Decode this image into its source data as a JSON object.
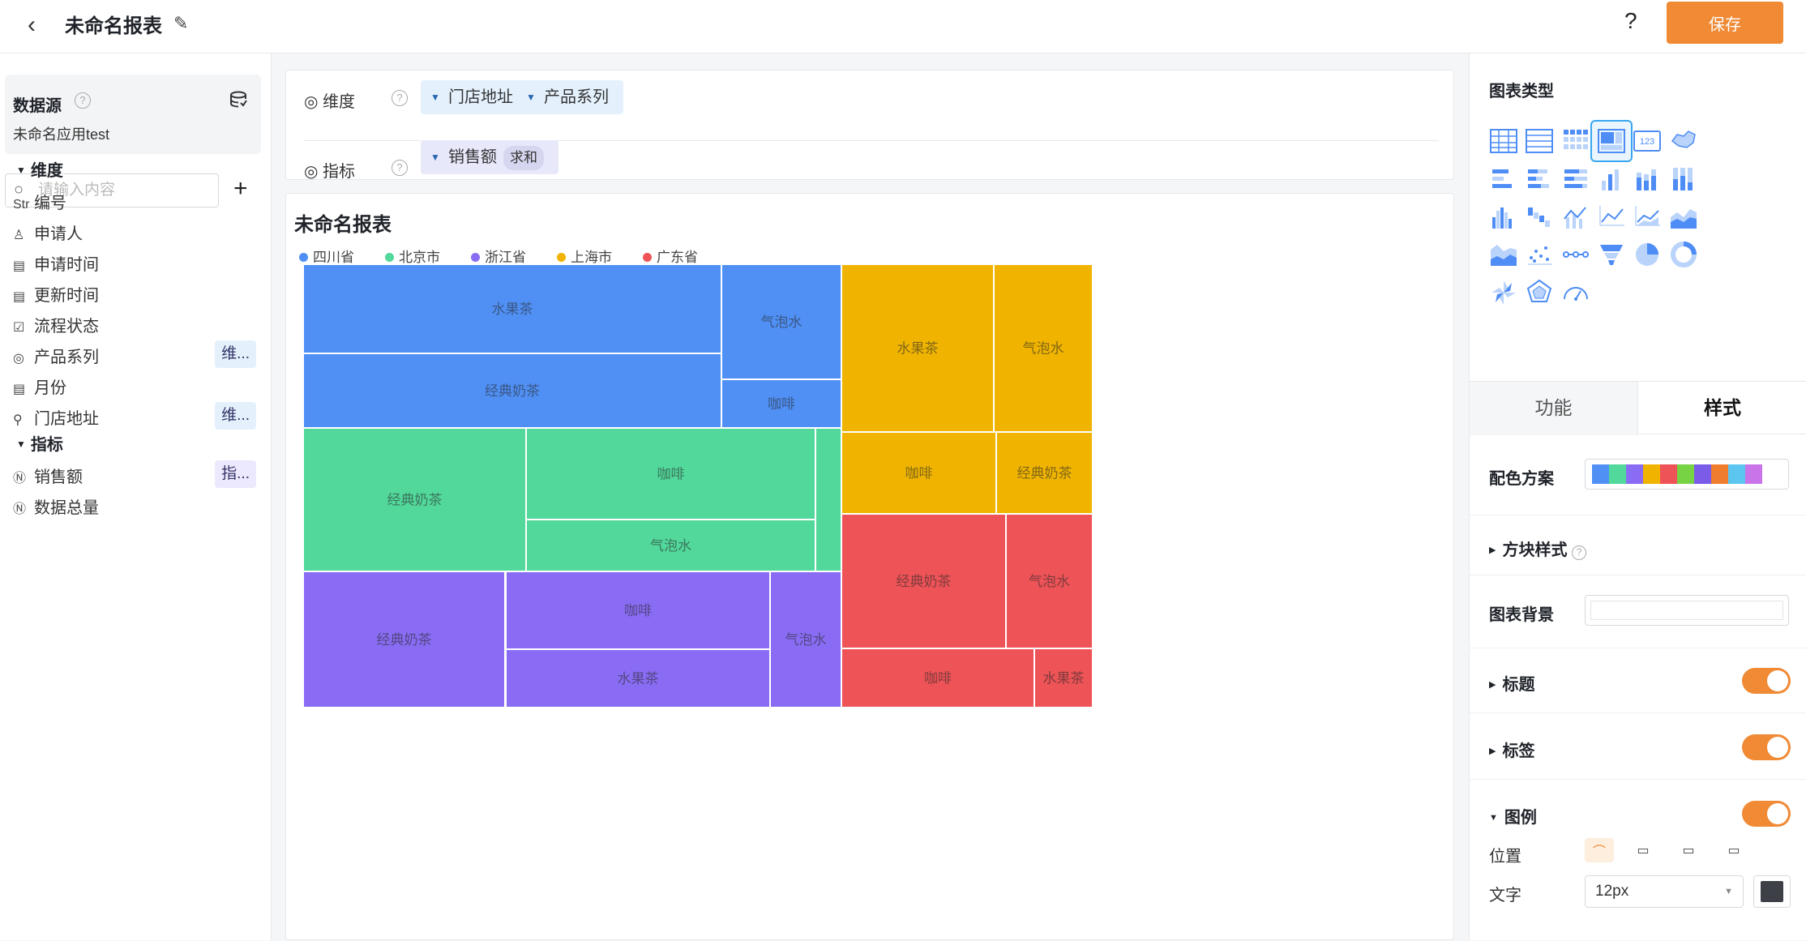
{
  "header": {
    "title": "未命名报表",
    "back_icon": "chevron-left-icon",
    "edit_icon": "pencil-icon",
    "help_label": "?",
    "save_label": "保存"
  },
  "sidebar": {
    "datasource_title": "数据源",
    "datasource_help": "?",
    "datasource_name": "未命名应用test",
    "search_placeholder": "请输入内容",
    "add_label": "+",
    "dimension_title": "维度",
    "metric_title": "指标",
    "dimensions": [
      {
        "icon": "Str",
        "label": "编号",
        "tag": ""
      },
      {
        "icon": "user-icon",
        "label": "申请人",
        "tag": ""
      },
      {
        "icon": "calendar-icon",
        "label": "申请时间",
        "tag": ""
      },
      {
        "icon": "calendar-icon",
        "label": "更新时间",
        "tag": ""
      },
      {
        "icon": "checkbox-icon",
        "label": "流程状态",
        "tag": ""
      },
      {
        "icon": "target-icon",
        "label": "产品系列",
        "tag": "维..."
      },
      {
        "icon": "calendar-icon",
        "label": "月份",
        "tag": ""
      },
      {
        "icon": "location-icon",
        "label": "门店地址",
        "tag": "维..."
      }
    ],
    "metrics": [
      {
        "icon": "number-icon",
        "label": "销售额",
        "tag": "指..."
      },
      {
        "icon": "number-icon",
        "label": "数据总量",
        "tag": ""
      }
    ]
  },
  "config": {
    "dimension_label": "维度",
    "metric_label": "指标",
    "help": "?",
    "dimension_pills": [
      "门店地址",
      "产品系列"
    ],
    "metric_pill": "销售额",
    "metric_agg": "求和"
  },
  "card": {
    "title": "未命名报表"
  },
  "chart_data": {
    "type": "treemap",
    "series": [
      {
        "name": "四川省",
        "color": "#5090f5",
        "items": [
          "水果茶",
          "经典奶茶",
          "气泡水",
          "咖啡"
        ]
      },
      {
        "name": "北京市",
        "color": "#52d89b",
        "items": [
          "经典奶茶",
          "咖啡",
          "气泡水",
          ""
        ]
      },
      {
        "name": "浙江省",
        "color": "#8a6cf4",
        "items": [
          "经典奶茶",
          "咖啡",
          "水果茶",
          "气泡水"
        ]
      },
      {
        "name": "上海市",
        "color": "#f0b400",
        "items": [
          "水果茶",
          "气泡水",
          "咖啡",
          "经典奶茶"
        ]
      },
      {
        "name": "广东省",
        "color": "#ee5357",
        "items": [
          "经典奶茶",
          "气泡水",
          "咖啡",
          "水果茶"
        ]
      }
    ]
  },
  "right_panel": {
    "chart_type_title": "图表类型",
    "selected_chart": "treemap",
    "chart_types": [
      "table-icon",
      "detail-table-icon",
      "pivot-table-icon",
      "treemap-icon",
      "indicator-card-icon",
      "map-icon",
      "bar-h-icon",
      "bar-h-stacked-icon",
      "bar-h-percent-icon",
      "column-icon",
      "column-stacked-icon",
      "column-percent-icon",
      "histogram-icon",
      "waterfall-icon",
      "column-line-icon",
      "line-icon",
      "area-line-icon",
      "area-icon",
      "area-percent-icon",
      "scatter-icon",
      "path-icon",
      "funnel-icon",
      "pie-icon",
      "ring-icon",
      "fan-icon",
      "radar-icon",
      "gauge-icon"
    ],
    "tabs": [
      "功能",
      "样式"
    ],
    "color_scheme_label": "配色方案",
    "color_scheme": [
      "#5090f5",
      "#52d89b",
      "#8a6cf4",
      "#f0b400",
      "#ee5357",
      "#77d244",
      "#7a5ce8",
      "#f07d2e",
      "#5cc6f0",
      "#c974e8"
    ],
    "block_style_label": "方块样式",
    "block_style_help": "?",
    "chart_bg_label": "图表背景",
    "title_label": "标题",
    "label_label": "标签",
    "legend_label": "图例",
    "position_label": "位置",
    "text_label": "文字",
    "font_size": "12px",
    "text_color": "#3d4147"
  }
}
